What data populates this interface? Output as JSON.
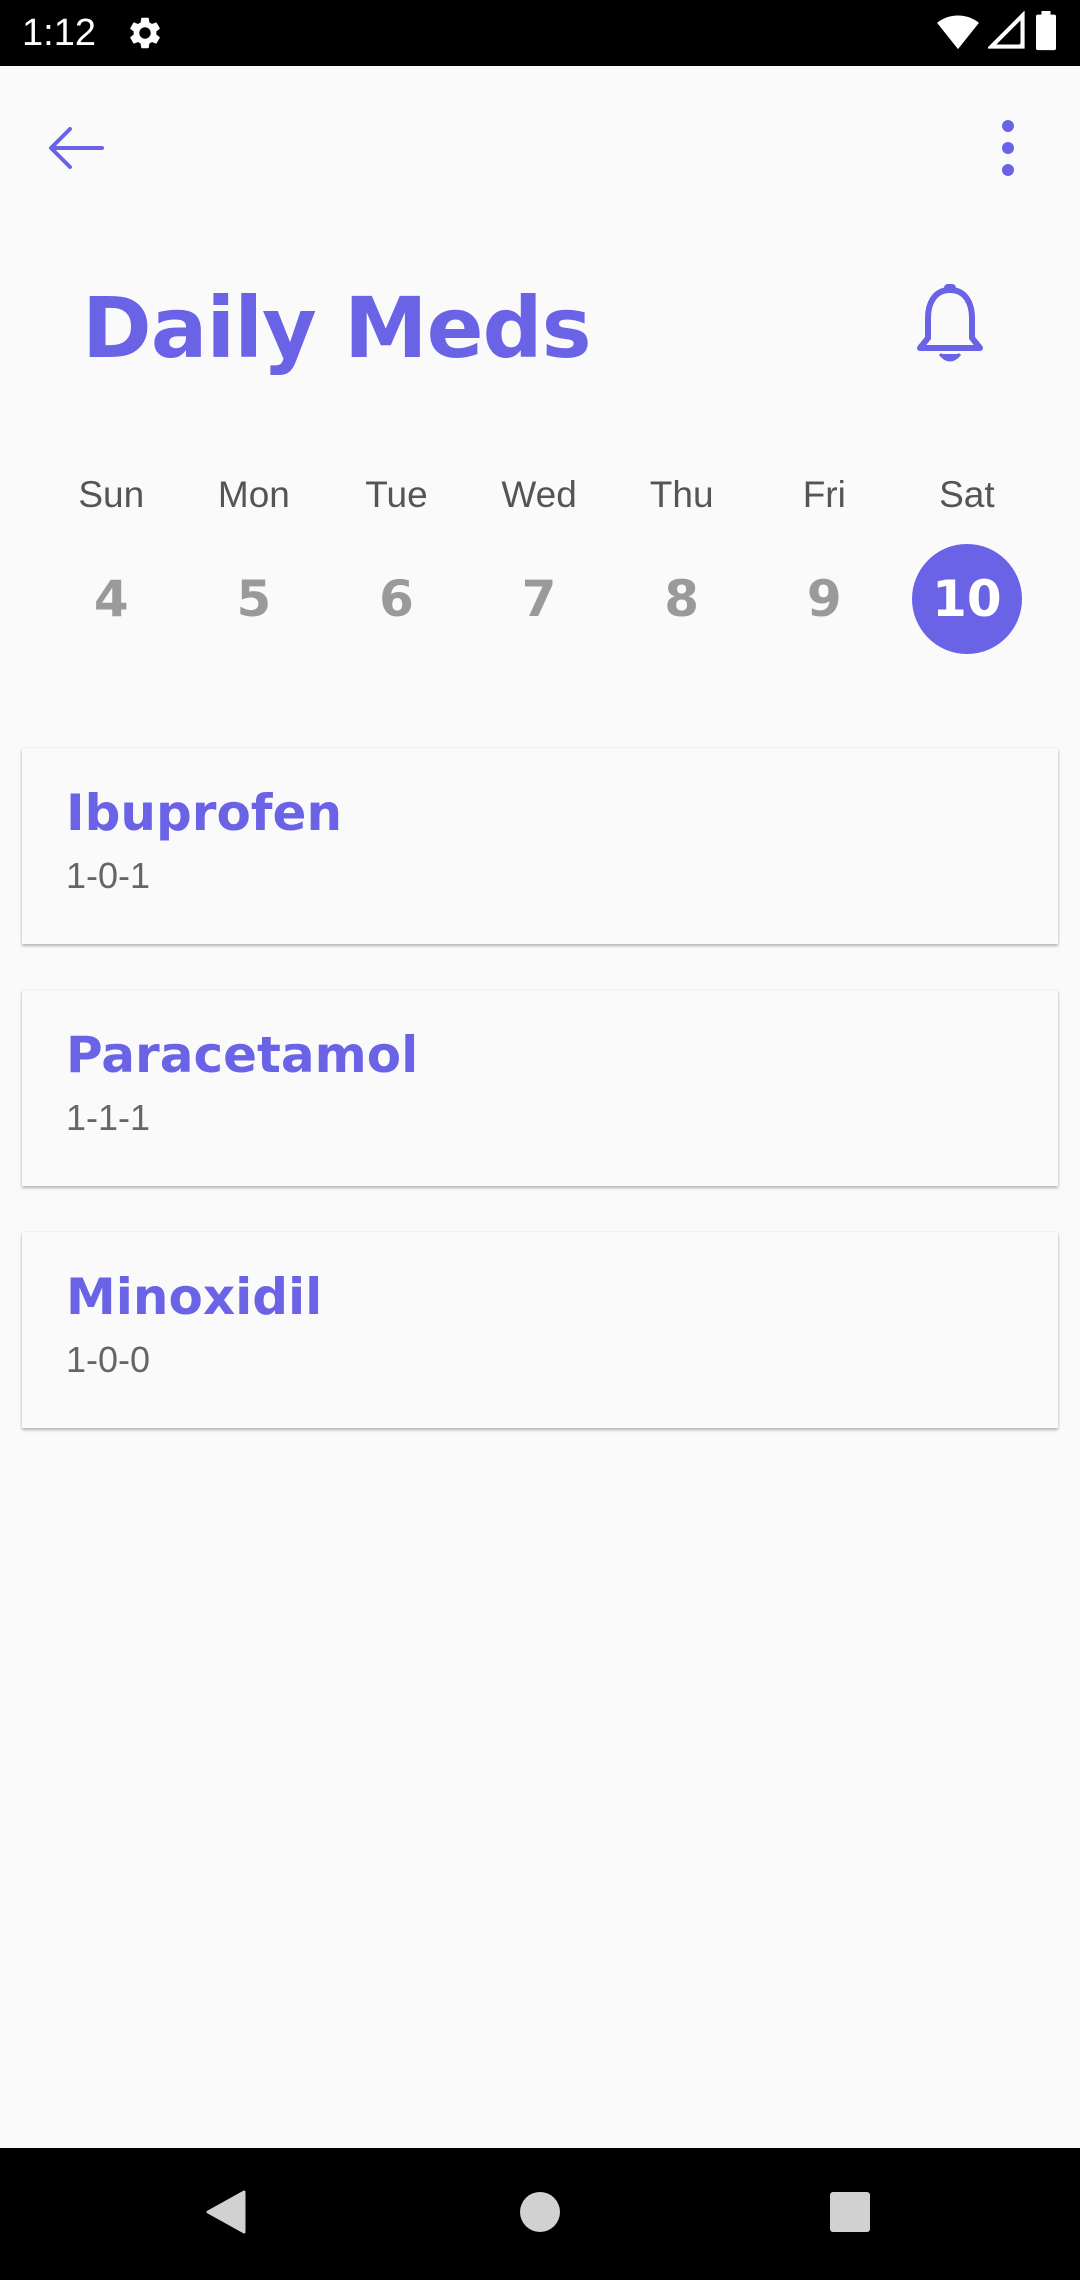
{
  "status_bar": {
    "time": "1:12",
    "icons": [
      "settings-icon",
      "wifi-icon",
      "signal-icon",
      "battery-icon"
    ]
  },
  "app_bar": {
    "back_icon": "arrow-back-icon",
    "menu_icon": "more-vert-icon"
  },
  "header": {
    "title": "Daily Meds",
    "bell_icon": "bell-icon"
  },
  "week": {
    "days": [
      {
        "name": "Sun",
        "date": "4",
        "selected": false
      },
      {
        "name": "Mon",
        "date": "5",
        "selected": false
      },
      {
        "name": "Tue",
        "date": "6",
        "selected": false
      },
      {
        "name": "Wed",
        "date": "7",
        "selected": false
      },
      {
        "name": "Thu",
        "date": "8",
        "selected": false
      },
      {
        "name": "Fri",
        "date": "9",
        "selected": false
      },
      {
        "name": "Sat",
        "date": "10",
        "selected": true
      }
    ]
  },
  "meds": [
    {
      "name": "Ibuprofen",
      "dose": "1-0-1"
    },
    {
      "name": "Paracetamol",
      "dose": "1-1-1"
    },
    {
      "name": "Minoxidil",
      "dose": "1-0-0"
    }
  ],
  "nav_bar": {
    "buttons": [
      "back-triangle-icon",
      "home-circle-icon",
      "recents-square-icon"
    ]
  },
  "colors": {
    "accent": "#6b63e6",
    "background": "#fafafa",
    "muted_text": "#9a9a9a"
  }
}
